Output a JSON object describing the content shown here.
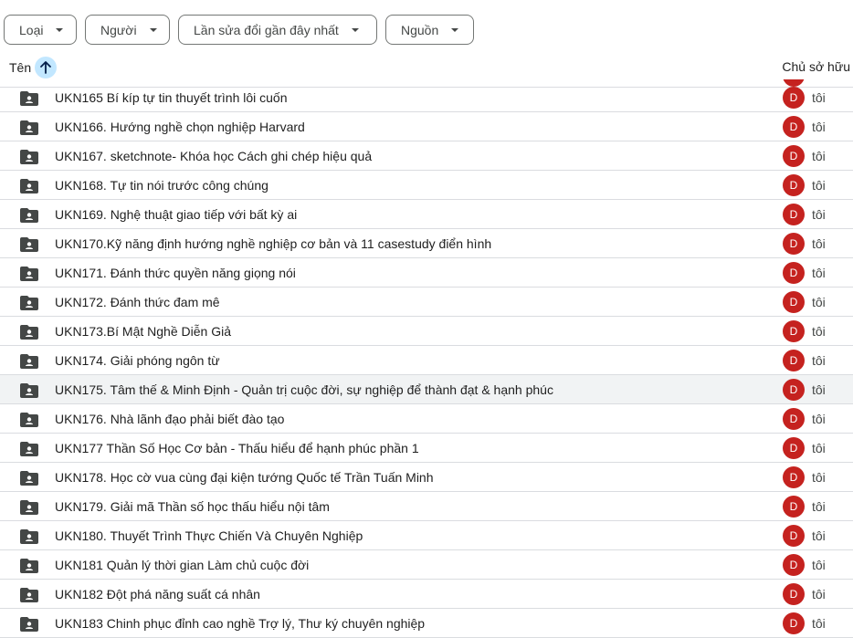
{
  "filters": {
    "type_label": "Loại",
    "people_label": "Người",
    "modified_label": "Lần sửa đổi gần đây nhất",
    "source_label": "Nguồn"
  },
  "header": {
    "name_label": "Tên",
    "owner_label": "Chủ sở hữu",
    "sort_direction": "ascending"
  },
  "colors": {
    "avatar_bg": "#c5221f",
    "sort_highlight": "#c2e7ff",
    "selected_row": "#f1f3f4"
  },
  "rows": [
    {
      "title": "UKN165  Bí kíp tự tin thuyết trình lôi cuốn",
      "avatar": "D",
      "owner": "tôi"
    },
    {
      "title": "UKN166. Hướng nghề chọn nghiệp Harvard",
      "avatar": "D",
      "owner": "tôi"
    },
    {
      "title": "UKN167. sketchnote- Khóa học Cách ghi chép hiệu quả",
      "avatar": "D",
      "owner": "tôi"
    },
    {
      "title": "UKN168. Tự tin nói trước công chúng",
      "avatar": "D",
      "owner": "tôi"
    },
    {
      "title": "UKN169. Nghệ thuật giao tiếp với bất kỳ ai",
      "avatar": "D",
      "owner": "tôi"
    },
    {
      "title": "UKN170.Kỹ năng định hướng nghề nghiệp cơ bản và 11 casestudy điển hình",
      "avatar": "D",
      "owner": "tôi"
    },
    {
      "title": "UKN171. Đánh thức quyền năng giọng nói",
      "avatar": "D",
      "owner": "tôi"
    },
    {
      "title": "UKN172. Đánh thức đam mê",
      "avatar": "D",
      "owner": "tôi"
    },
    {
      "title": "UKN173.Bí Mật Nghề Diễn Giả",
      "avatar": "D",
      "owner": "tôi"
    },
    {
      "title": "UKN174. Giải phóng ngôn từ",
      "avatar": "D",
      "owner": "tôi"
    },
    {
      "title": "UKN175. Tâm thế & Minh Định - Quản trị cuộc đời, sự nghiệp để thành đạt & hạnh phúc",
      "avatar": "D",
      "owner": "tôi",
      "selected": true
    },
    {
      "title": "UKN176. Nhà lãnh đạo phải biết đào tạo",
      "avatar": "D",
      "owner": "tôi"
    },
    {
      "title": "UKN177  Thần Số Học Cơ bản - Thấu hiểu để hạnh phúc phần 1",
      "avatar": "D",
      "owner": "tôi"
    },
    {
      "title": "UKN178. Học cờ vua cùng đại kiện tướng Quốc tế Trần Tuấn Minh",
      "avatar": "D",
      "owner": "tôi"
    },
    {
      "title": "UKN179. Giải mã Thần số học thấu hiểu nội tâm",
      "avatar": "D",
      "owner": "tôi"
    },
    {
      "title": "UKN180. Thuyết Trình Thực Chiến Và Chuyên Nghiệp",
      "avatar": "D",
      "owner": "tôi"
    },
    {
      "title": "UKN181 Quản lý thời gian Làm chủ cuộc đời",
      "avatar": "D",
      "owner": "tôi"
    },
    {
      "title": "UKN182  Đột phá năng suất cá nhân",
      "avatar": "D",
      "owner": "tôi"
    },
    {
      "title": "UKN183  Chinh phục đỉnh cao nghề Trợ lý, Thư ký chuyên nghiệp",
      "avatar": "D",
      "owner": "tôi"
    }
  ]
}
